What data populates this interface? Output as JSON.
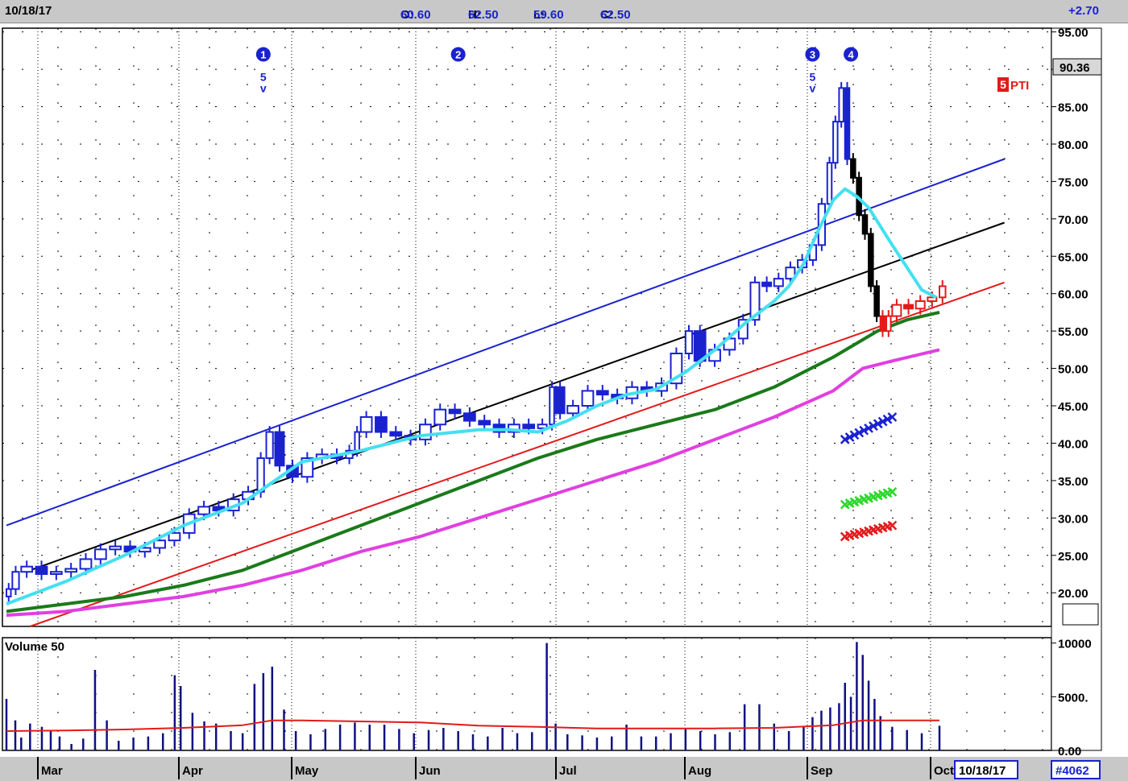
{
  "header": {
    "date": "10/18/17",
    "open_label": "O:",
    "open": "60.60",
    "high_label": "H:",
    "high": "62.50",
    "low_label": "L:",
    "low": "59.60",
    "close_label": "C:",
    "close": "62.50",
    "change": "+2.70"
  },
  "footer": {
    "date_box": "10/18/17",
    "id_box": "#4062"
  },
  "price_box": "90.36",
  "pti": {
    "num": "5",
    "label": "PTI"
  },
  "volume_label": "Volume 50",
  "colors": {
    "up_bar": "#1a22d0",
    "down_bar": "#000000",
    "recent_bar": "#e21a1a",
    "ma_cyan": "#44e0f0",
    "ma_green": "#1a7a1a",
    "ma_magenta": "#e040e0",
    "channel_blue": "#1a22d0",
    "channel_black": "#000000",
    "channel_red": "#e21a1a"
  },
  "chart_data": {
    "type": "candlestick",
    "x_ticks": [
      "Mar",
      "Apr",
      "May",
      "Jun",
      "Jul",
      "Aug",
      "Sep",
      "Oct"
    ],
    "y_ticks": [
      "95.00",
      "90.00",
      "85.00",
      "80.00",
      "75.00",
      "70.00",
      "65.00",
      "60.00",
      "55.00",
      "50.00",
      "45.00",
      "40.00",
      "35.00",
      "30.00",
      "25.00",
      "20.00"
    ],
    "ylim": [
      15.5,
      95.5
    ],
    "volume_ticks": [
      "10000",
      "5000.",
      "0.00"
    ],
    "volume_ylim": [
      0,
      10500
    ],
    "closes": [
      [
        0,
        20.5
      ],
      [
        2,
        22.8
      ],
      [
        5,
        23.5
      ],
      [
        10,
        22.5
      ],
      [
        15,
        22.8
      ],
      [
        20,
        23.2
      ],
      [
        25,
        24.5
      ],
      [
        30,
        25.8
      ],
      [
        35,
        26.2
      ],
      [
        40,
        25.5
      ],
      [
        45,
        26.0
      ],
      [
        50,
        27.0
      ],
      [
        55,
        28.0
      ],
      [
        60,
        30.5
      ],
      [
        65,
        31.5
      ],
      [
        70,
        31.0
      ],
      [
        75,
        32.5
      ],
      [
        80,
        33.5
      ],
      [
        85,
        38.0
      ],
      [
        88,
        41.5
      ],
      [
        91,
        37.0
      ],
      [
        95,
        35.5
      ],
      [
        100,
        38.0
      ],
      [
        105,
        38.5
      ],
      [
        110,
        38.0
      ],
      [
        115,
        39.0
      ],
      [
        118,
        41.5
      ],
      [
        120,
        43.5
      ],
      [
        125,
        41.5
      ],
      [
        130,
        41.0
      ],
      [
        135,
        40.5
      ],
      [
        140,
        42.5
      ],
      [
        145,
        44.5
      ],
      [
        150,
        44.0
      ],
      [
        155,
        43.0
      ],
      [
        160,
        42.5
      ],
      [
        165,
        41.5
      ],
      [
        170,
        42.5
      ],
      [
        175,
        42.0
      ],
      [
        180,
        42.5
      ],
      [
        184,
        47.5
      ],
      [
        186,
        44.0
      ],
      [
        190,
        45.0
      ],
      [
        195,
        47.0
      ],
      [
        200,
        46.5
      ],
      [
        205,
        46.0
      ],
      [
        210,
        47.5
      ],
      [
        215,
        47.0
      ],
      [
        220,
        48.0
      ],
      [
        225,
        52.0
      ],
      [
        230,
        55.0
      ],
      [
        233,
        51.0
      ],
      [
        238,
        52.5
      ],
      [
        243,
        54.0
      ],
      [
        248,
        56.5
      ],
      [
        252,
        61.5
      ],
      [
        256,
        61.0
      ],
      [
        260,
        62.0
      ],
      [
        264,
        63.5
      ],
      [
        268,
        64.5
      ],
      [
        272,
        66.5
      ],
      [
        275,
        72.0
      ],
      [
        278,
        77.5
      ],
      [
        280,
        83.0
      ],
      [
        282,
        87.5
      ],
      [
        284,
        78.0
      ],
      [
        286,
        75.5
      ],
      [
        288,
        70.5
      ],
      [
        290,
        68.0
      ],
      [
        292,
        61.0
      ],
      [
        294,
        57.0
      ],
      [
        296,
        55.0
      ],
      [
        298,
        57.0
      ],
      [
        300,
        58.5
      ],
      [
        304,
        58.0
      ],
      [
        308,
        59.0
      ],
      [
        312,
        59.5
      ],
      [
        316,
        61.0
      ]
    ],
    "ma_cyan": [
      [
        0,
        18.5
      ],
      [
        20,
        21.5
      ],
      [
        40,
        25.0
      ],
      [
        60,
        29.0
      ],
      [
        80,
        32.0
      ],
      [
        100,
        37.5
      ],
      [
        120,
        39.0
      ],
      [
        140,
        41.0
      ],
      [
        160,
        41.8
      ],
      [
        170,
        41.8
      ],
      [
        180,
        41.5
      ],
      [
        190,
        43.0
      ],
      [
        200,
        45.0
      ],
      [
        210,
        46.5
      ],
      [
        220,
        47.2
      ],
      [
        230,
        49.5
      ],
      [
        240,
        52.5
      ],
      [
        250,
        56.0
      ],
      [
        260,
        59.0
      ],
      [
        265,
        61.0
      ],
      [
        270,
        64.0
      ],
      [
        275,
        68.5
      ],
      [
        280,
        72.5
      ],
      [
        284,
        74.0
      ],
      [
        288,
        73.0
      ],
      [
        292,
        71.5
      ],
      [
        296,
        69.0
      ],
      [
        300,
        66.5
      ],
      [
        305,
        63.5
      ],
      [
        310,
        60.5
      ],
      [
        315,
        59.5
      ]
    ],
    "ma_green": [
      [
        0,
        17.5
      ],
      [
        20,
        18.5
      ],
      [
        40,
        19.5
      ],
      [
        60,
        21.0
      ],
      [
        80,
        23.0
      ],
      [
        100,
        26.0
      ],
      [
        120,
        29.0
      ],
      [
        140,
        32.0
      ],
      [
        160,
        35.0
      ],
      [
        180,
        38.0
      ],
      [
        200,
        40.5
      ],
      [
        220,
        42.5
      ],
      [
        240,
        44.5
      ],
      [
        260,
        47.5
      ],
      [
        280,
        51.5
      ],
      [
        295,
        55.0
      ],
      [
        305,
        56.5
      ],
      [
        316,
        57.5
      ]
    ],
    "ma_magenta": [
      [
        0,
        17.0
      ],
      [
        20,
        17.5
      ],
      [
        40,
        18.5
      ],
      [
        60,
        19.5
      ],
      [
        80,
        21.0
      ],
      [
        100,
        23.0
      ],
      [
        120,
        25.5
      ],
      [
        140,
        27.5
      ],
      [
        160,
        30.0
      ],
      [
        180,
        32.5
      ],
      [
        200,
        35.0
      ],
      [
        220,
        37.5
      ],
      [
        240,
        40.5
      ],
      [
        260,
        43.5
      ],
      [
        280,
        47.0
      ],
      [
        290,
        50.0
      ],
      [
        300,
        51.0
      ],
      [
        316,
        52.5
      ]
    ],
    "channel_blue": [
      [
        0,
        29.0
      ],
      [
        338,
        78.0
      ]
    ],
    "channel_black": [
      [
        8,
        23.0
      ],
      [
        338,
        69.5
      ]
    ],
    "channel_red": [
      [
        8,
        15.5
      ],
      [
        338,
        61.5
      ]
    ],
    "projection_blue_x": [
      [
        284,
        40.5
      ],
      [
        300,
        43.5
      ]
    ],
    "projection_green_x": [
      [
        284,
        31.8
      ],
      [
        300,
        33.5
      ]
    ],
    "projection_red_x": [
      [
        284,
        27.5
      ],
      [
        300,
        29.0
      ]
    ],
    "wave_labels": [
      {
        "t": "1",
        "x": 87,
        "y": 92.0,
        "k": "circle"
      },
      {
        "t": "5",
        "x": 87,
        "y": 89.0,
        "k": "blue"
      },
      {
        "t": "v",
        "x": 87,
        "y": 87.5,
        "k": "blue"
      },
      {
        "t": "2",
        "x": 153,
        "y": 92.0,
        "k": "circle"
      },
      {
        "t": "3",
        "x": 273,
        "y": 92.0,
        "k": "circle"
      },
      {
        "t": "5",
        "x": 273,
        "y": 89.0,
        "k": "blue"
      },
      {
        "t": "v",
        "x": 273,
        "y": 87.5,
        "k": "blue"
      },
      {
        "t": "4",
        "x": 286,
        "y": 92.0,
        "k": "circle"
      }
    ],
    "volumes": [
      [
        0,
        4800
      ],
      [
        3,
        2800
      ],
      [
        5,
        1200
      ],
      [
        8,
        2500
      ],
      [
        12,
        2200
      ],
      [
        15,
        1800
      ],
      [
        18,
        1300
      ],
      [
        22,
        600
      ],
      [
        26,
        1100
      ],
      [
        30,
        7500
      ],
      [
        34,
        2800
      ],
      [
        38,
        900
      ],
      [
        43,
        1200
      ],
      [
        48,
        1300
      ],
      [
        53,
        1600
      ],
      [
        57,
        7000
      ],
      [
        59,
        6000
      ],
      [
        63,
        3500
      ],
      [
        67,
        2700
      ],
      [
        71,
        2500
      ],
      [
        76,
        1800
      ],
      [
        80,
        1600
      ],
      [
        84,
        6200
      ],
      [
        87,
        7200
      ],
      [
        90,
        7800
      ],
      [
        94,
        3800
      ],
      [
        98,
        1800
      ],
      [
        103,
        1500
      ],
      [
        108,
        2000
      ],
      [
        113,
        2400
      ],
      [
        118,
        2600
      ],
      [
        123,
        2400
      ],
      [
        128,
        2400
      ],
      [
        133,
        2000
      ],
      [
        138,
        1600
      ],
      [
        143,
        1900
      ],
      [
        148,
        2100
      ],
      [
        153,
        1800
      ],
      [
        158,
        1500
      ],
      [
        163,
        1300
      ],
      [
        168,
        2100
      ],
      [
        173,
        1600
      ],
      [
        178,
        1700
      ],
      [
        183,
        10000
      ],
      [
        186,
        2500
      ],
      [
        190,
        1500
      ],
      [
        195,
        1400
      ],
      [
        200,
        1200
      ],
      [
        205,
        1300
      ],
      [
        210,
        2400
      ],
      [
        215,
        1300
      ],
      [
        220,
        1300
      ],
      [
        225,
        1600
      ],
      [
        230,
        2100
      ],
      [
        235,
        1800
      ],
      [
        240,
        1500
      ],
      [
        245,
        1700
      ],
      [
        250,
        4300
      ],
      [
        255,
        4300
      ],
      [
        260,
        2500
      ],
      [
        265,
        1800
      ],
      [
        270,
        2200
      ],
      [
        273,
        3100
      ],
      [
        276,
        3700
      ],
      [
        279,
        4000
      ],
      [
        282,
        4400
      ],
      [
        284,
        6300
      ],
      [
        286,
        5000
      ],
      [
        288,
        10100
      ],
      [
        290,
        8900
      ],
      [
        292,
        6500
      ],
      [
        294,
        4800
      ],
      [
        296,
        3200
      ],
      [
        300,
        2200
      ],
      [
        305,
        1900
      ],
      [
        310,
        1600
      ],
      [
        316,
        2300
      ]
    ],
    "volume_avg": [
      [
        0,
        1800
      ],
      [
        20,
        1850
      ],
      [
        40,
        1950
      ],
      [
        60,
        2100
      ],
      [
        80,
        2350
      ],
      [
        90,
        2800
      ],
      [
        100,
        2800
      ],
      [
        120,
        2700
      ],
      [
        140,
        2600
      ],
      [
        160,
        2300
      ],
      [
        180,
        2200
      ],
      [
        200,
        2050
      ],
      [
        220,
        2050
      ],
      [
        240,
        2050
      ],
      [
        260,
        2100
      ],
      [
        280,
        2350
      ],
      [
        290,
        2800
      ],
      [
        316,
        2800
      ]
    ]
  }
}
